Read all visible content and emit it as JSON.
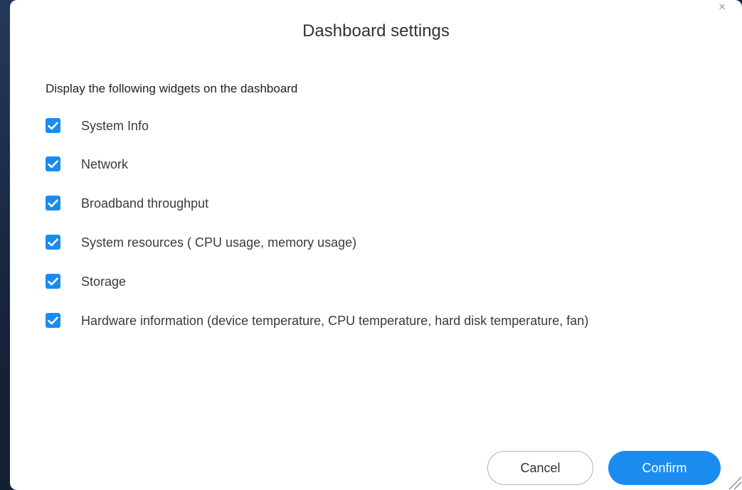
{
  "dialog": {
    "title": "Dashboard settings",
    "close_icon": "close-icon",
    "section_label": "Display the following widgets on the dashboard",
    "options": [
      {
        "label": "System Info",
        "checked": true
      },
      {
        "label": "Network",
        "checked": true
      },
      {
        "label": "Broadband throughput",
        "checked": true
      },
      {
        "label": "System resources ( CPU usage, memory usage)",
        "checked": true
      },
      {
        "label": "Storage",
        "checked": true
      },
      {
        "label": "Hardware information (device temperature, CPU temperature, hard disk temperature, fan)",
        "checked": true
      }
    ],
    "buttons": {
      "cancel_label": "Cancel",
      "confirm_label": "Confirm"
    }
  },
  "colors": {
    "accent": "#1a8cf0",
    "backdrop": "#1b2940"
  }
}
